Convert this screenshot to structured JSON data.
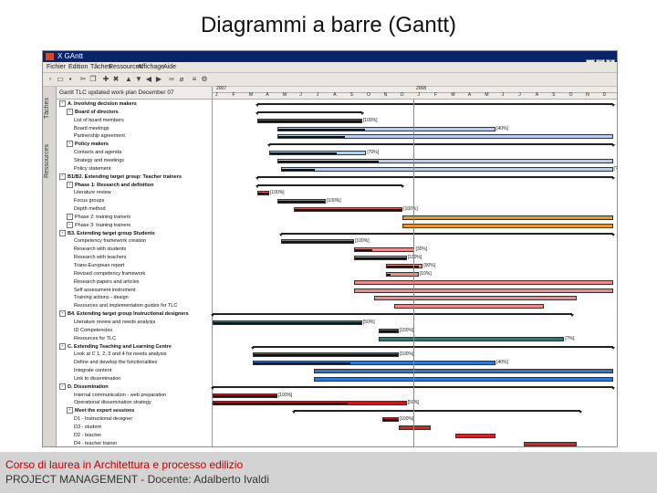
{
  "slide_title": "Diagrammi a barre (Gantt)",
  "window": {
    "title": "X GAntt",
    "menu": [
      "Fichier",
      "Edition",
      "Tâches",
      "Ressources",
      "Affichage",
      "Aide"
    ],
    "controls": [
      "_",
      "□",
      "X"
    ],
    "sidebar_tabs": [
      "Tâches",
      "Ressources"
    ],
    "task_header": "Gantt TLC updated work plan December 07"
  },
  "timeline": {
    "years": [
      "2007",
      "2008"
    ],
    "months": [
      "J",
      "F",
      "M",
      "A",
      "M",
      "J",
      "J",
      "A",
      "S",
      "O",
      "N",
      "D",
      "J",
      "F",
      "M",
      "A",
      "M",
      "J",
      "J",
      "A",
      "S",
      "O",
      "N",
      "D"
    ]
  },
  "tasks": [
    {
      "label": "A. Involving decision makers",
      "bold": true,
      "level": 0
    },
    {
      "label": "Board of directors",
      "bold": true,
      "level": 1
    },
    {
      "label": "List of board members",
      "bold": false,
      "level": 2
    },
    {
      "label": "Board meetings",
      "bold": false,
      "level": 2
    },
    {
      "label": "Partnership agreement",
      "bold": false,
      "level": 2
    },
    {
      "label": "Policy makers",
      "bold": true,
      "level": 1
    },
    {
      "label": "Contacts and agenda",
      "bold": false,
      "level": 2
    },
    {
      "label": "Strategy and meetings",
      "bold": false,
      "level": 2
    },
    {
      "label": "Policy statement",
      "bold": false,
      "level": 2
    },
    {
      "label": "B1/B2. Extending target group: Teacher trainers",
      "bold": true,
      "level": 0
    },
    {
      "label": "Phase 1: Research and definition",
      "bold": true,
      "level": 1
    },
    {
      "label": "Literature review",
      "bold": false,
      "level": 2
    },
    {
      "label": "Focus groups",
      "bold": false,
      "level": 2
    },
    {
      "label": "Depth method",
      "bold": false,
      "level": 2
    },
    {
      "label": "Phase 2: training trainers",
      "bold": false,
      "level": 1
    },
    {
      "label": "Phase 3: training trainers",
      "bold": false,
      "level": 1
    },
    {
      "label": "B3. Extending target group Students",
      "bold": true,
      "level": 0
    },
    {
      "label": "Competency framework creation",
      "bold": false,
      "level": 2
    },
    {
      "label": "Research with students",
      "bold": false,
      "level": 2
    },
    {
      "label": "Research with teachers",
      "bold": false,
      "level": 2
    },
    {
      "label": "Trans-European report",
      "bold": false,
      "level": 2
    },
    {
      "label": "Revised competency framework",
      "bold": false,
      "level": 2
    },
    {
      "label": "Research papers and articles",
      "bold": false,
      "level": 2
    },
    {
      "label": "Self assessment instrument",
      "bold": false,
      "level": 2
    },
    {
      "label": "Training actions - design",
      "bold": false,
      "level": 2
    },
    {
      "label": "Resources and implementation guides for TLC",
      "bold": false,
      "level": 2
    },
    {
      "label": "B4. Extending target group Instructional designers",
      "bold": true,
      "level": 0
    },
    {
      "label": "Literature review and needs analysis",
      "bold": false,
      "level": 2
    },
    {
      "label": "ID Competencies",
      "bold": false,
      "level": 2
    },
    {
      "label": "Resources for TLC",
      "bold": false,
      "level": 2
    },
    {
      "label": "C. Extending Teaching and Learning Centre",
      "bold": true,
      "level": 0
    },
    {
      "label": "Look at C 1, 2, 3 and 4 for needs analysis",
      "bold": false,
      "level": 2
    },
    {
      "label": "Define and develop the functionalities",
      "bold": false,
      "level": 2
    },
    {
      "label": "Integrate content",
      "bold": false,
      "level": 2
    },
    {
      "label": "Link to dissemination",
      "bold": false,
      "level": 2
    },
    {
      "label": "D. Dissemination",
      "bold": true,
      "level": 0
    },
    {
      "label": "Internal communication - web preparation",
      "bold": false,
      "level": 2
    },
    {
      "label": "Operational dissemination strategy",
      "bold": false,
      "level": 2
    },
    {
      "label": "Meet the expert sessions",
      "bold": true,
      "level": 1
    },
    {
      "label": "D1 - Instructional designer",
      "bold": false,
      "level": 2
    },
    {
      "label": "D3 - student",
      "bold": false,
      "level": 2
    },
    {
      "label": "D2 - teacher",
      "bold": false,
      "level": 2
    },
    {
      "label": "D4 - teacher trainer",
      "bold": false,
      "level": 2
    }
  ],
  "gantt_bars": [
    {
      "type": "summary",
      "start": 0.11,
      "end": 0.99
    },
    {
      "type": "summary",
      "start": 0.11,
      "end": 0.37
    },
    {
      "type": "bar",
      "start": 0.11,
      "end": 0.37,
      "color": "#2a5ca8",
      "progress": 1.0,
      "label": "[100%]"
    },
    {
      "type": "bar",
      "start": 0.16,
      "end": 0.7,
      "color": "#b8d0ee",
      "progress": 0.4,
      "label": "[40%]"
    },
    {
      "type": "bar",
      "start": 0.16,
      "end": 0.99,
      "color": "#b8d0ee",
      "progress": 0.2,
      "label": ""
    },
    {
      "type": "summary",
      "start": 0.14,
      "end": 0.99
    },
    {
      "type": "bar",
      "start": 0.14,
      "end": 0.38,
      "color": "#b8d0ee",
      "progress": 0.7,
      "label": "[70%]"
    },
    {
      "type": "bar",
      "start": 0.16,
      "end": 0.99,
      "color": "#b8d0ee",
      "progress": 0.3,
      "label": ""
    },
    {
      "type": "bar",
      "start": 0.17,
      "end": 0.99,
      "color": "#b8d0ee",
      "progress": 0.1,
      "label": "[?%]"
    },
    {
      "type": "summary",
      "start": 0.11,
      "end": 0.99
    },
    {
      "type": "summary",
      "start": 0.11,
      "end": 0.47
    },
    {
      "type": "bar",
      "start": 0.11,
      "end": 0.14,
      "color": "#e05a5a",
      "progress": 1.0,
      "label": "[100%]"
    },
    {
      "type": "bar",
      "start": 0.16,
      "end": 0.28,
      "color": "#e05a5a",
      "progress": 1.0,
      "label": "[100%]"
    },
    {
      "type": "bar",
      "start": 0.2,
      "end": 0.47,
      "color": "#e05a5a",
      "progress": 1.0,
      "label": "[100%]"
    },
    {
      "type": "bar",
      "start": 0.47,
      "end": 0.99,
      "color": "#f0981f",
      "progress": 0,
      "label": ""
    },
    {
      "type": "bar",
      "start": 0.47,
      "end": 0.99,
      "color": "#f0981f",
      "progress": 0,
      "label": ""
    },
    {
      "type": "summary",
      "start": 0.17,
      "end": 0.99
    },
    {
      "type": "bar",
      "start": 0.17,
      "end": 0.35,
      "color": "#e05a5a",
      "progress": 1.0,
      "label": "[100%]"
    },
    {
      "type": "bar",
      "start": 0.35,
      "end": 0.5,
      "color": "#f08a8a",
      "progress": 0.3,
      "label": "[30%]"
    },
    {
      "type": "bar",
      "start": 0.35,
      "end": 0.48,
      "color": "#f08a8a",
      "progress": 1.0,
      "label": "[100%]"
    },
    {
      "type": "bar",
      "start": 0.43,
      "end": 0.52,
      "color": "#f08a8a",
      "progress": 0.9,
      "label": "[90%]"
    },
    {
      "type": "bar",
      "start": 0.43,
      "end": 0.51,
      "color": "#f08a8a",
      "progress": 0.1,
      "label": "[10%]"
    },
    {
      "type": "bar",
      "start": 0.35,
      "end": 0.99,
      "color": "#f08a8a",
      "progress": 0,
      "label": ""
    },
    {
      "type": "bar",
      "start": 0.35,
      "end": 0.99,
      "color": "#f08a8a",
      "progress": 0,
      "label": ""
    },
    {
      "type": "bar",
      "start": 0.4,
      "end": 0.9,
      "color": "#f08a8a",
      "progress": 0,
      "label": ""
    },
    {
      "type": "bar",
      "start": 0.45,
      "end": 0.82,
      "color": "#f08a8a",
      "progress": 0,
      "label": ""
    },
    {
      "type": "summary",
      "start": 0.0,
      "end": 0.89
    },
    {
      "type": "bar",
      "start": 0.0,
      "end": 0.37,
      "color": "#3b6e6e",
      "progress": 1.0,
      "label": "[50%]"
    },
    {
      "type": "bar",
      "start": 0.41,
      "end": 0.46,
      "color": "#3b6e6e",
      "progress": 1.0,
      "label": "[100%]"
    },
    {
      "type": "bar",
      "start": 0.41,
      "end": 0.87,
      "color": "#3b6e6e",
      "progress": 0,
      "label": "[?%]"
    },
    {
      "type": "summary",
      "start": 0.1,
      "end": 0.99
    },
    {
      "type": "bar",
      "start": 0.1,
      "end": 0.46,
      "color": "#2a5ca8",
      "progress": 1.0,
      "label": "[100%]"
    },
    {
      "type": "bar",
      "start": 0.1,
      "end": 0.7,
      "color": "#2a78d8",
      "progress": 0.4,
      "label": "[40%]"
    },
    {
      "type": "bar",
      "start": 0.25,
      "end": 0.99,
      "color": "#2a78d8",
      "progress": 0,
      "label": ""
    },
    {
      "type": "bar",
      "start": 0.25,
      "end": 0.99,
      "color": "#2a78d8",
      "progress": 0,
      "label": ""
    },
    {
      "type": "summary",
      "start": 0.0,
      "end": 0.99
    },
    {
      "type": "bar",
      "start": 0.0,
      "end": 0.16,
      "color": "#c8181c",
      "progress": 1.0,
      "label": "[100%]"
    },
    {
      "type": "bar",
      "start": 0.0,
      "end": 0.48,
      "color": "#c8181c",
      "progress": 0.7,
      "label": "[50%]"
    },
    {
      "type": "summary",
      "start": 0.2,
      "end": 0.91
    },
    {
      "type": "bar",
      "start": 0.42,
      "end": 0.46,
      "color": "#c8181c",
      "progress": 1.0,
      "label": "[100%]"
    },
    {
      "type": "bar",
      "start": 0.46,
      "end": 0.54,
      "color": "#e02020",
      "progress": 0,
      "label": ""
    },
    {
      "type": "bar",
      "start": 0.6,
      "end": 0.7,
      "color": "#e02020",
      "progress": 0,
      "label": ""
    },
    {
      "type": "bar",
      "start": 0.77,
      "end": 0.9,
      "color": "#e02020",
      "progress": 0,
      "label": ""
    }
  ],
  "footer": {
    "line1": "Corso di laurea in Architettura e processo edilizio",
    "line2": "PROJECT MANAGEMENT - Docente: Adalberto Ivaldi"
  }
}
